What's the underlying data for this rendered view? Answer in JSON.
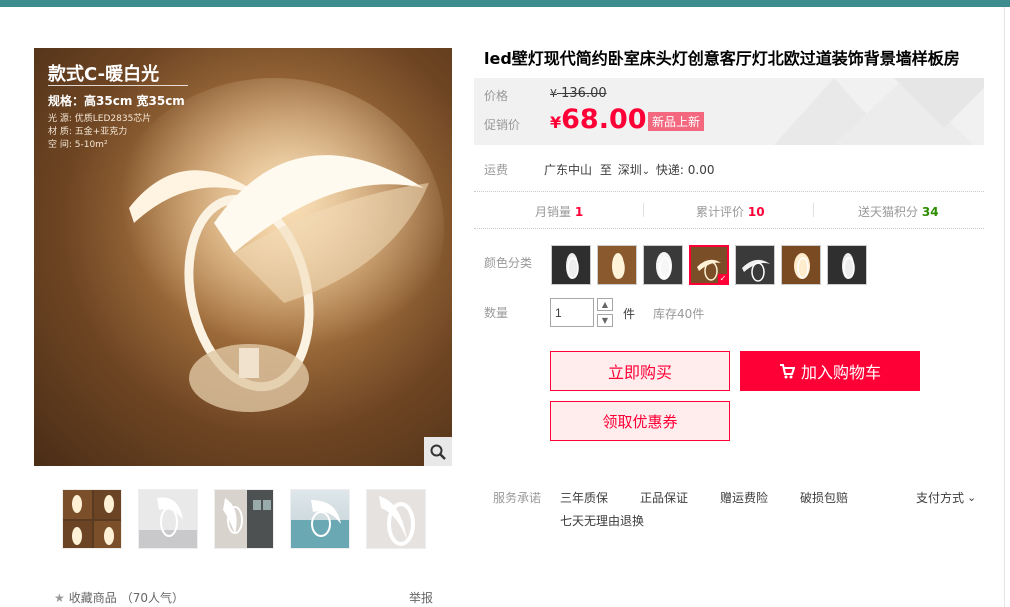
{
  "product": {
    "title": "led壁灯现代简约卧室床头灯创意客厅灯北欧过道装饰背景墙样板房",
    "image": {
      "tag_title": "款式C-暖白光",
      "tag_spec": "规格：高35cm 宽35cm",
      "tag_light": "光 源: 优质LED2835芯片",
      "tag_material": "材 质: 五金+亚克力",
      "tag_space": "空 间: 5-10m²"
    }
  },
  "price": {
    "label": "价格",
    "currency": "¥",
    "original": "136.00",
    "promo_label": "促销价",
    "promo": "68.00",
    "new_tag": "新品上新"
  },
  "shipping": {
    "label": "运费",
    "from": "广东中山",
    "to_word": "至",
    "to": "深圳",
    "express": "快递: 0.00"
  },
  "stats": {
    "monthly_label": "月销量",
    "monthly": "1",
    "reviews_label": "累计评价",
    "reviews": "10",
    "points_label": "送天猫积分",
    "points": "34"
  },
  "color": {
    "label": "颜色分类",
    "selected_index": 3
  },
  "quantity": {
    "label": "数量",
    "value": "1",
    "unit": "件",
    "stock": "库存40件"
  },
  "buttons": {
    "buy": "立即购买",
    "cart": "加入购物车",
    "coupon": "领取优惠券"
  },
  "services": {
    "label": "服务承诺",
    "items": [
      "三年质保",
      "正品保证",
      "赠运费险",
      "破损包赔"
    ],
    "item5": "七天无理由退换",
    "pay": "支付方式"
  },
  "footer": {
    "favorite": "收藏商品",
    "popularity": "（70人气）",
    "report": "举报"
  },
  "colors": {
    "accent": "#ff0036",
    "topbar": "#3d8c8e",
    "green": "#2d8c00"
  }
}
